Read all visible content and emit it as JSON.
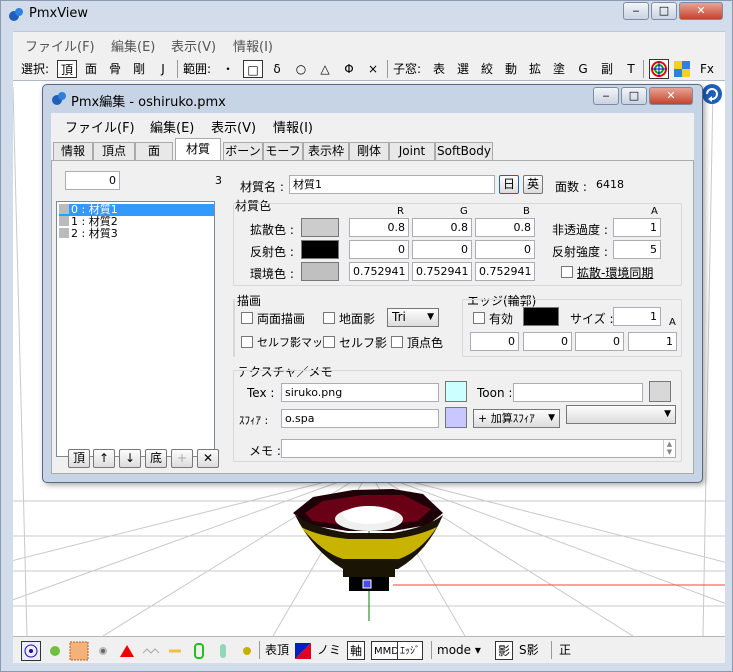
{
  "app": {
    "title": "PmxView",
    "controls": {
      "min": "‒",
      "max": "□",
      "close": "✕"
    }
  },
  "main_menu": [
    "ファイル(F)",
    "編集(E)",
    "表示(V)",
    "情報(I)"
  ],
  "toolbar": {
    "select_label": "選択:",
    "select_items": [
      "頂",
      "面",
      "骨",
      "剛",
      "J"
    ],
    "range_label": "範囲:",
    "range_items": [
      "・",
      "□",
      "δ",
      "○",
      "△",
      "Φ",
      "×"
    ],
    "child_label": "子窓:",
    "child_items": [
      "表",
      "選",
      "絞",
      "動",
      "拡",
      "塗",
      "G",
      "副",
      "T"
    ],
    "fx_label": "Fx"
  },
  "statusbar": {
    "vertex_label": "表頂",
    "mino_label": "ノミ",
    "axis_label": "軸",
    "mo_label": "MMD",
    "edge_label": "ｴｯｼﾞ",
    "mode_label": "mode",
    "shadow_label": "影",
    "sshadow_label": "S影",
    "ortho_label": "正"
  },
  "editor": {
    "title": "Pmx編集 - oshiruko.pmx",
    "menu": [
      "ファイル(F)",
      "編集(E)",
      "表示(V)",
      "情報(I)"
    ],
    "tabs": [
      "情報",
      "頂点",
      "面",
      "材質",
      "ボーン",
      "モーフ",
      "表示枠",
      "剛体",
      "Joint",
      "SoftBody"
    ],
    "active_tab": "材質",
    "list": {
      "index_value": "0",
      "count": "3",
      "items": [
        "0 : 材質1",
        "1 : 材質2",
        "2 : 材質3"
      ],
      "buttons": [
        "頂",
        "↑",
        "↓",
        "底",
        "+",
        "✕"
      ]
    },
    "material": {
      "name_label": "材質名 :",
      "name_value": "材質1",
      "lang_jp": "日",
      "lang_en": "英",
      "face_count_label": "面数 :",
      "face_count_value": "6418",
      "color_label": "材質色",
      "rgb_headers": [
        "R",
        "G",
        "B"
      ],
      "a_header": "A",
      "diffuse_label": "拡散色 :",
      "diffuse": [
        "0.8",
        "0.8",
        "0.8"
      ],
      "specular_label": "反射色 :",
      "specular": [
        "0",
        "0",
        "0"
      ],
      "ambient_label": "環境色 :",
      "ambient": [
        "0.752941",
        "0.752941",
        "0.752941"
      ],
      "alpha_label": "非透過度 :",
      "alpha_value": "1",
      "spec_power_label": "反射強度 :",
      "spec_power_value": "5",
      "sync_label": "拡散-環境同期",
      "draw_label": "描画",
      "double_side_label": "両面描画",
      "ground_shadow_label": "地面影",
      "draw_mode_value": "Tri",
      "self_shadow_map_label": "セルフ影マップ",
      "self_shadow_label": "セルフ影",
      "vertex_color_label": "頂点色",
      "edge_label": "エッジ(輪郭)",
      "edge_enabled_label": "有効",
      "edge_size_label": "サイズ :",
      "edge_size_value": "1",
      "edge_a_header": "A",
      "edge_color": [
        "0",
        "0",
        "0",
        "1"
      ],
      "texture_section_label": "テクスチャ／メモ",
      "tex_label": "Tex :",
      "tex_value": "siruko.png",
      "toon_label": "Toon :",
      "toon_value": "",
      "sphere_label": "ｽﾌｨｱ :",
      "sphere_value": "o.spa",
      "sphere_mode_value": "+ 加算ｽﾌｨｱ",
      "toon_select_value": "",
      "memo_label": "メモ :",
      "memo_value": ""
    }
  },
  "colors": {
    "diffuse_swatch": "#cccccc",
    "specular_swatch": "#000000",
    "ambient_swatch": "#c0c0c0",
    "edge_swatch": "#000000",
    "tex_swatch": "#ccffff",
    "toon_swatch": "#d8d8d8",
    "sphere_swatch": "#c8c8ff",
    "selection": "#3399ff"
  }
}
